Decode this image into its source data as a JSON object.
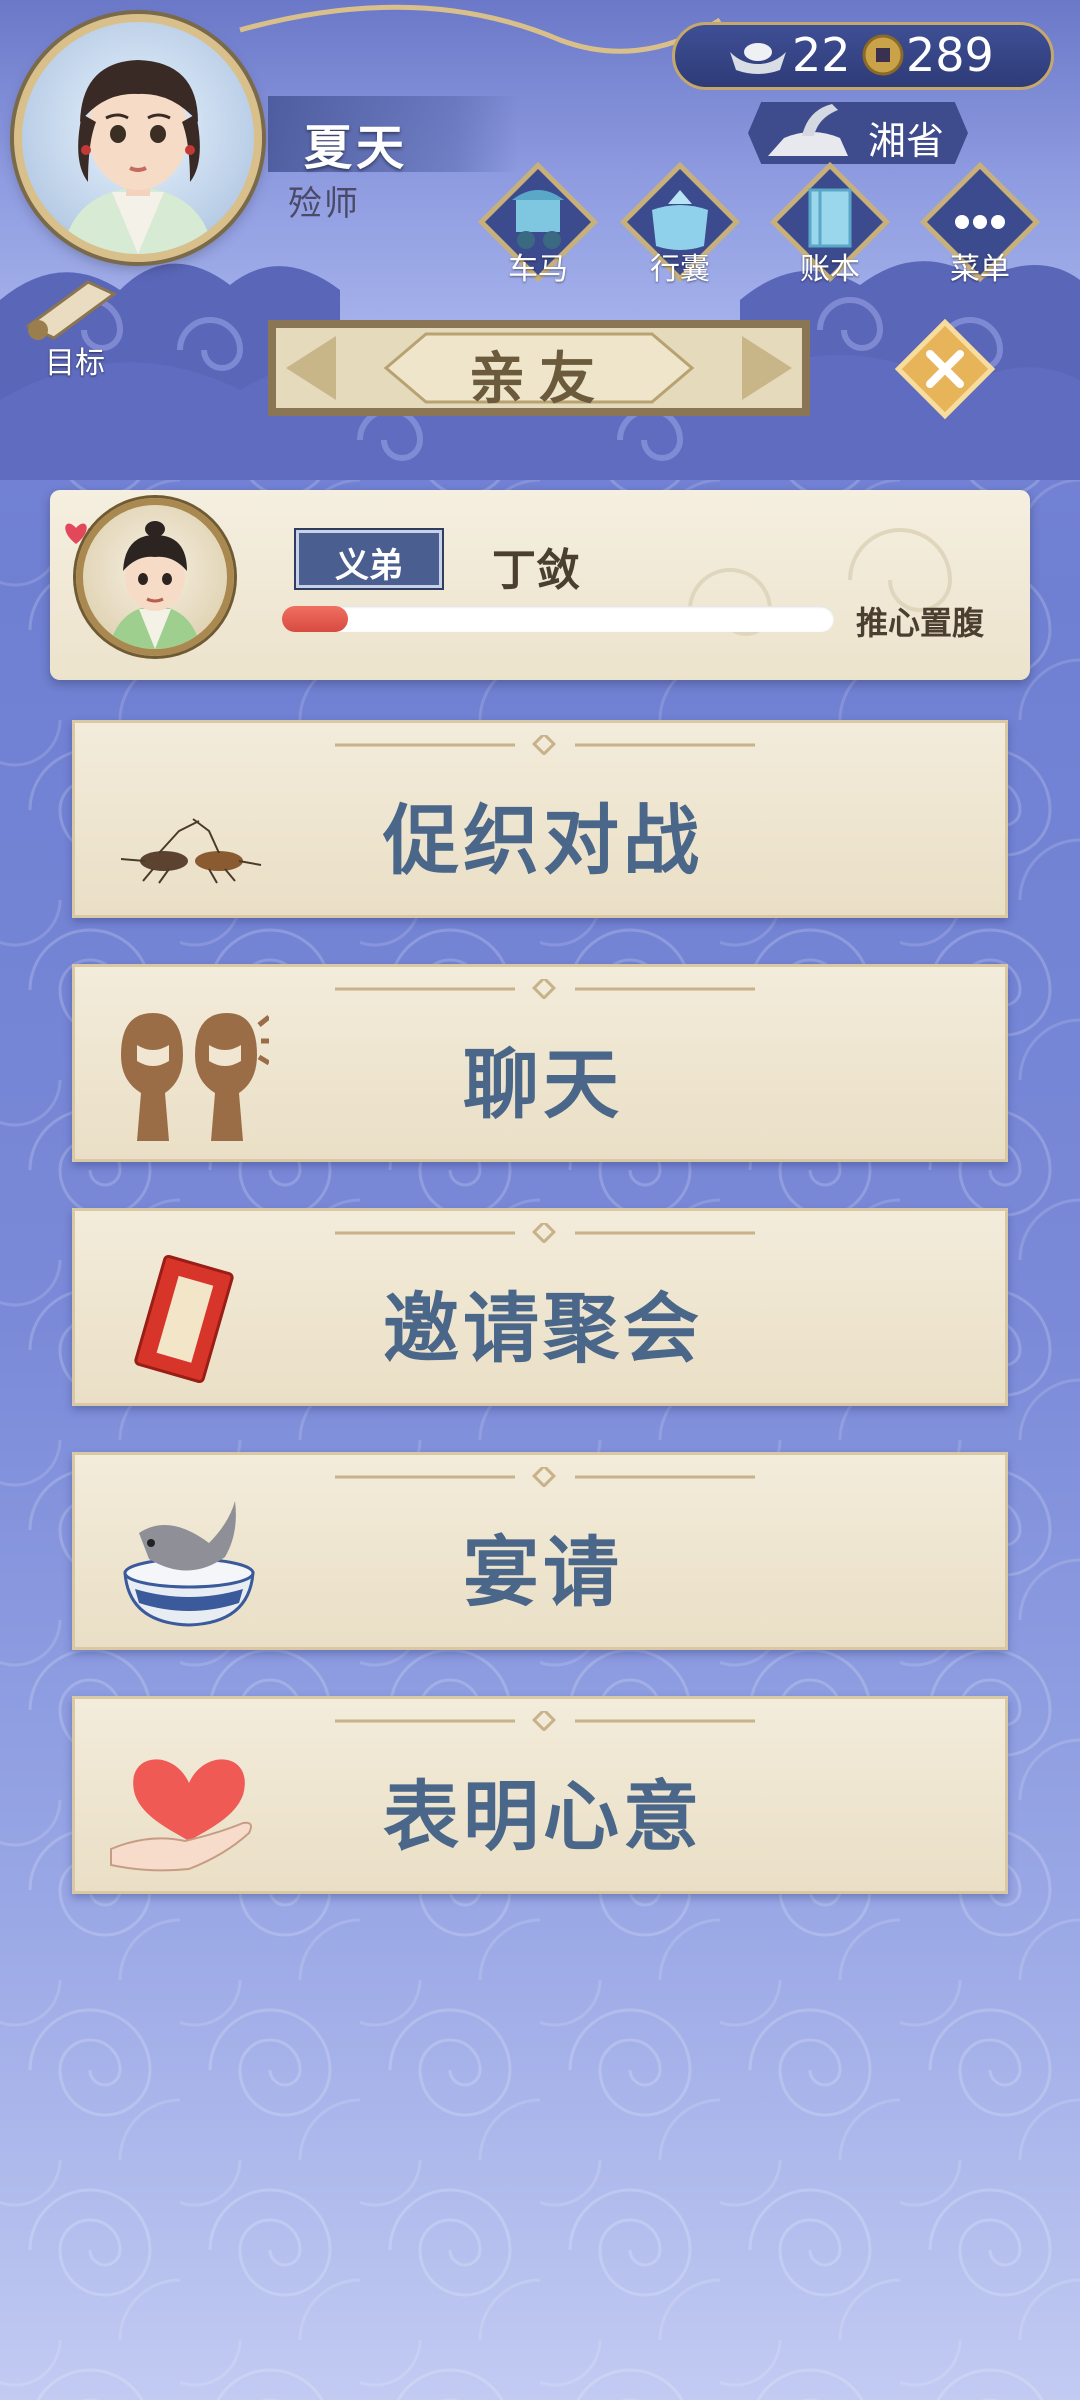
{
  "player": {
    "name": "夏天",
    "title": "殓师"
  },
  "currency": {
    "silver": "22",
    "copper": "289"
  },
  "region": "湘省",
  "top_menu": [
    {
      "label": "车马",
      "icon": "carriage-icon"
    },
    {
      "label": "行囊",
      "icon": "bundle-icon"
    },
    {
      "label": "账本",
      "icon": "ledger-icon"
    },
    {
      "label": "菜单",
      "icon": "more-icon"
    }
  ],
  "goal_label": "目标",
  "screen_title": "亲友",
  "friend": {
    "relation": "义弟",
    "name": "丁敛",
    "affinity_level": "推心置腹",
    "affinity_progress": 0.12
  },
  "actions": [
    {
      "label": "促织对战",
      "icon": "cricket-icon"
    },
    {
      "label": "聊天",
      "icon": "chat-icon"
    },
    {
      "label": "邀请聚会",
      "icon": "invitation-card-icon"
    },
    {
      "label": "宴请",
      "icon": "fish-bowl-icon"
    },
    {
      "label": "表明心意",
      "icon": "heart-hand-icon"
    }
  ],
  "colors": {
    "background": "#7483d4",
    "action_text": "#4a6688",
    "affinity_bar": "#e0554a",
    "gold_trim": "#d9c08a"
  }
}
